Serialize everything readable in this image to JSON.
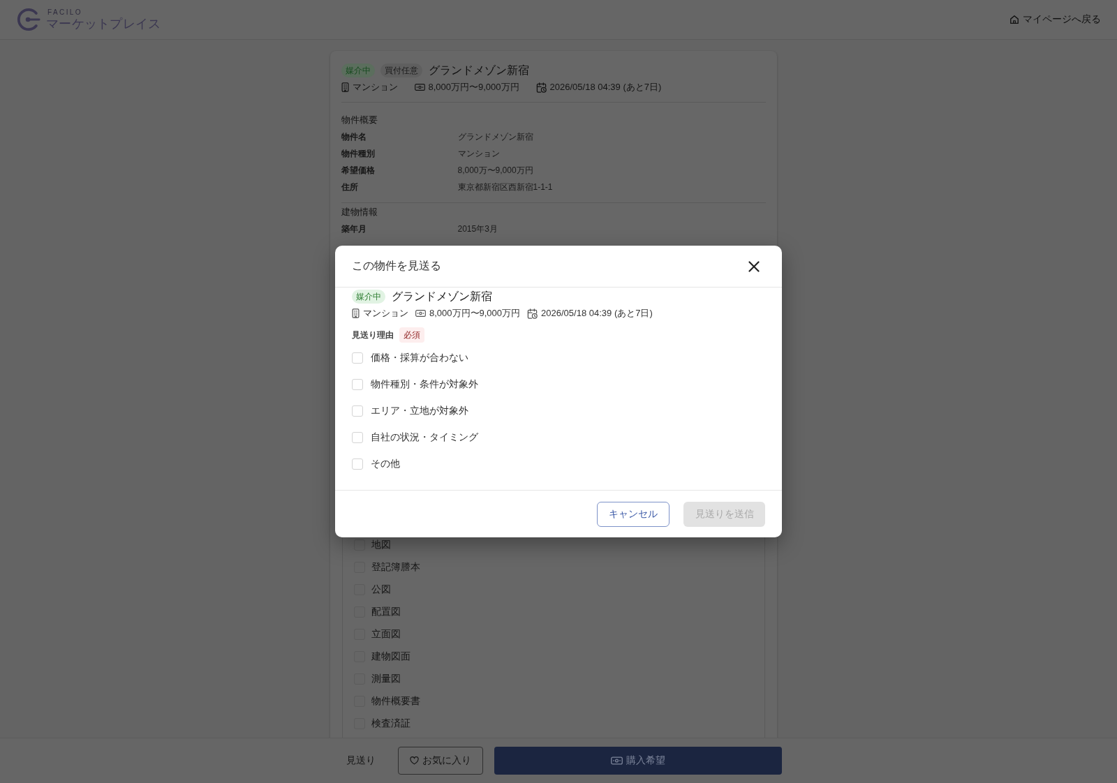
{
  "header": {
    "logo": {
      "brand": "FACILO",
      "product": "マーケットプレイス"
    },
    "back_link": "マイページへ戻る"
  },
  "property": {
    "badges": [
      {
        "label": "媒介中",
        "kind": "status"
      },
      {
        "label": "買付任意",
        "kind": "neutral"
      }
    ],
    "title": "グランドメゾン新宿",
    "meta": [
      {
        "kind": "type",
        "text": "マンション"
      },
      {
        "kind": "price",
        "text": "8,000万円〜9,000万円"
      },
      {
        "kind": "deadline",
        "text": "2026/05/18 04:39 (あと7日)"
      }
    ],
    "sections": [
      {
        "heading": "物件概要",
        "rows": [
          {
            "label": "物件名",
            "value": "グランドメゾン新宿"
          },
          {
            "label": "物件種別",
            "value": "マンション"
          },
          {
            "label": "希望価格",
            "value": "8,000万〜9,000万円"
          },
          {
            "label": "住所",
            "value": "東京都新宿区西新宿1-1-1"
          }
        ]
      },
      {
        "heading": "建物情報",
        "rows": [
          {
            "label": "築年月",
            "value": "2015年3月"
          }
        ]
      }
    ],
    "documents": [
      {
        "label": "地図",
        "checked": false
      },
      {
        "label": "登記簿謄本",
        "checked": false
      },
      {
        "label": "公図",
        "checked": false
      },
      {
        "label": "配置図",
        "checked": false
      },
      {
        "label": "立面図",
        "checked": false
      },
      {
        "label": "建物図面",
        "checked": false
      },
      {
        "label": "測量図",
        "checked": false
      },
      {
        "label": "物件概要書",
        "checked": false
      },
      {
        "label": "検査済証",
        "checked": false
      }
    ]
  },
  "modal": {
    "title": "この物件を見送る",
    "badges": [
      {
        "label": "媒介中",
        "kind": "status"
      }
    ],
    "property_title": "グランドメゾン新宿",
    "meta": [
      {
        "kind": "type",
        "text": "マンション"
      },
      {
        "kind": "price",
        "text": "8,000万円〜9,000万円"
      },
      {
        "kind": "deadline",
        "text": "2026/05/18 04:39 (あと7日)"
      }
    ],
    "reason_label": "見送り理由",
    "required_badge": "必須",
    "reasons": [
      {
        "label": "価格・採算が合わない",
        "checked": false
      },
      {
        "label": "物件種別・条件が対象外",
        "checked": false
      },
      {
        "label": "エリア・立地が対象外",
        "checked": false
      },
      {
        "label": "自社の状況・タイミング",
        "checked": false
      },
      {
        "label": "その他",
        "checked": false
      }
    ],
    "buttons": [
      {
        "label": "キャンセル",
        "kind": "secondary",
        "disabled": false
      },
      {
        "label": "見送りを送信",
        "kind": "primary",
        "disabled": true
      }
    ]
  },
  "action_bar": {
    "buttons": [
      {
        "label": "見送り",
        "kind": "text"
      },
      {
        "label": "お気に入り",
        "kind": "favorite"
      },
      {
        "label": "購入希望",
        "kind": "purchase"
      }
    ]
  }
}
